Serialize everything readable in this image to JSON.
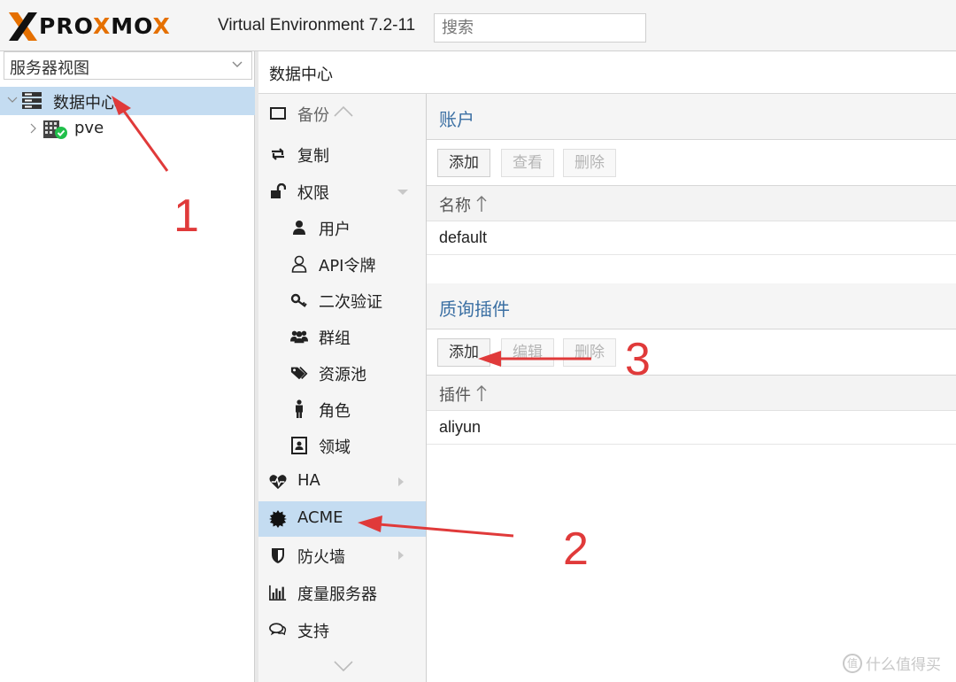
{
  "header": {
    "logo_text": "PROXMOX",
    "version": "Virtual Environment 7.2-11",
    "search_placeholder": "搜索"
  },
  "tree": {
    "view_select": "服务器视图",
    "items": [
      {
        "label": "数据中心",
        "selected": true
      },
      {
        "label": "pve",
        "selected": false
      }
    ]
  },
  "content": {
    "title": "数据中心"
  },
  "menu": {
    "items": [
      {
        "label": "备份",
        "icon": "backup-icon"
      },
      {
        "label": "复制",
        "icon": "replication-icon"
      },
      {
        "label": "权限",
        "icon": "unlock-icon"
      },
      {
        "label": "用户",
        "icon": "user-icon"
      },
      {
        "label": "API令牌",
        "icon": "user-outline-icon"
      },
      {
        "label": "二次验证",
        "icon": "key-icon"
      },
      {
        "label": "群组",
        "icon": "users-icon"
      },
      {
        "label": "资源池",
        "icon": "tags-icon"
      },
      {
        "label": "角色",
        "icon": "male-icon"
      },
      {
        "label": "领域",
        "icon": "address-book-icon"
      },
      {
        "label": "HA",
        "icon": "heartbeat-icon"
      },
      {
        "label": "ACME",
        "icon": "certificate-icon",
        "selected": true
      },
      {
        "label": "防火墙",
        "icon": "shield-icon"
      },
      {
        "label": "度量服务器",
        "icon": "bar-chart-icon"
      },
      {
        "label": "支持",
        "icon": "comments-icon"
      }
    ]
  },
  "accounts": {
    "title": "账户",
    "buttons": {
      "add": "添加",
      "view": "查看",
      "remove": "删除"
    },
    "column": "名称",
    "rows": [
      "default"
    ]
  },
  "plugins": {
    "title": "质询插件",
    "buttons": {
      "add": "添加",
      "edit": "编辑",
      "remove": "删除"
    },
    "column": "插件",
    "rows": [
      "aliyun"
    ]
  },
  "annotations": {
    "n1": "1",
    "n2": "2",
    "n3": "3",
    "accent": "#e03a3a"
  },
  "watermark": "什么值得买"
}
